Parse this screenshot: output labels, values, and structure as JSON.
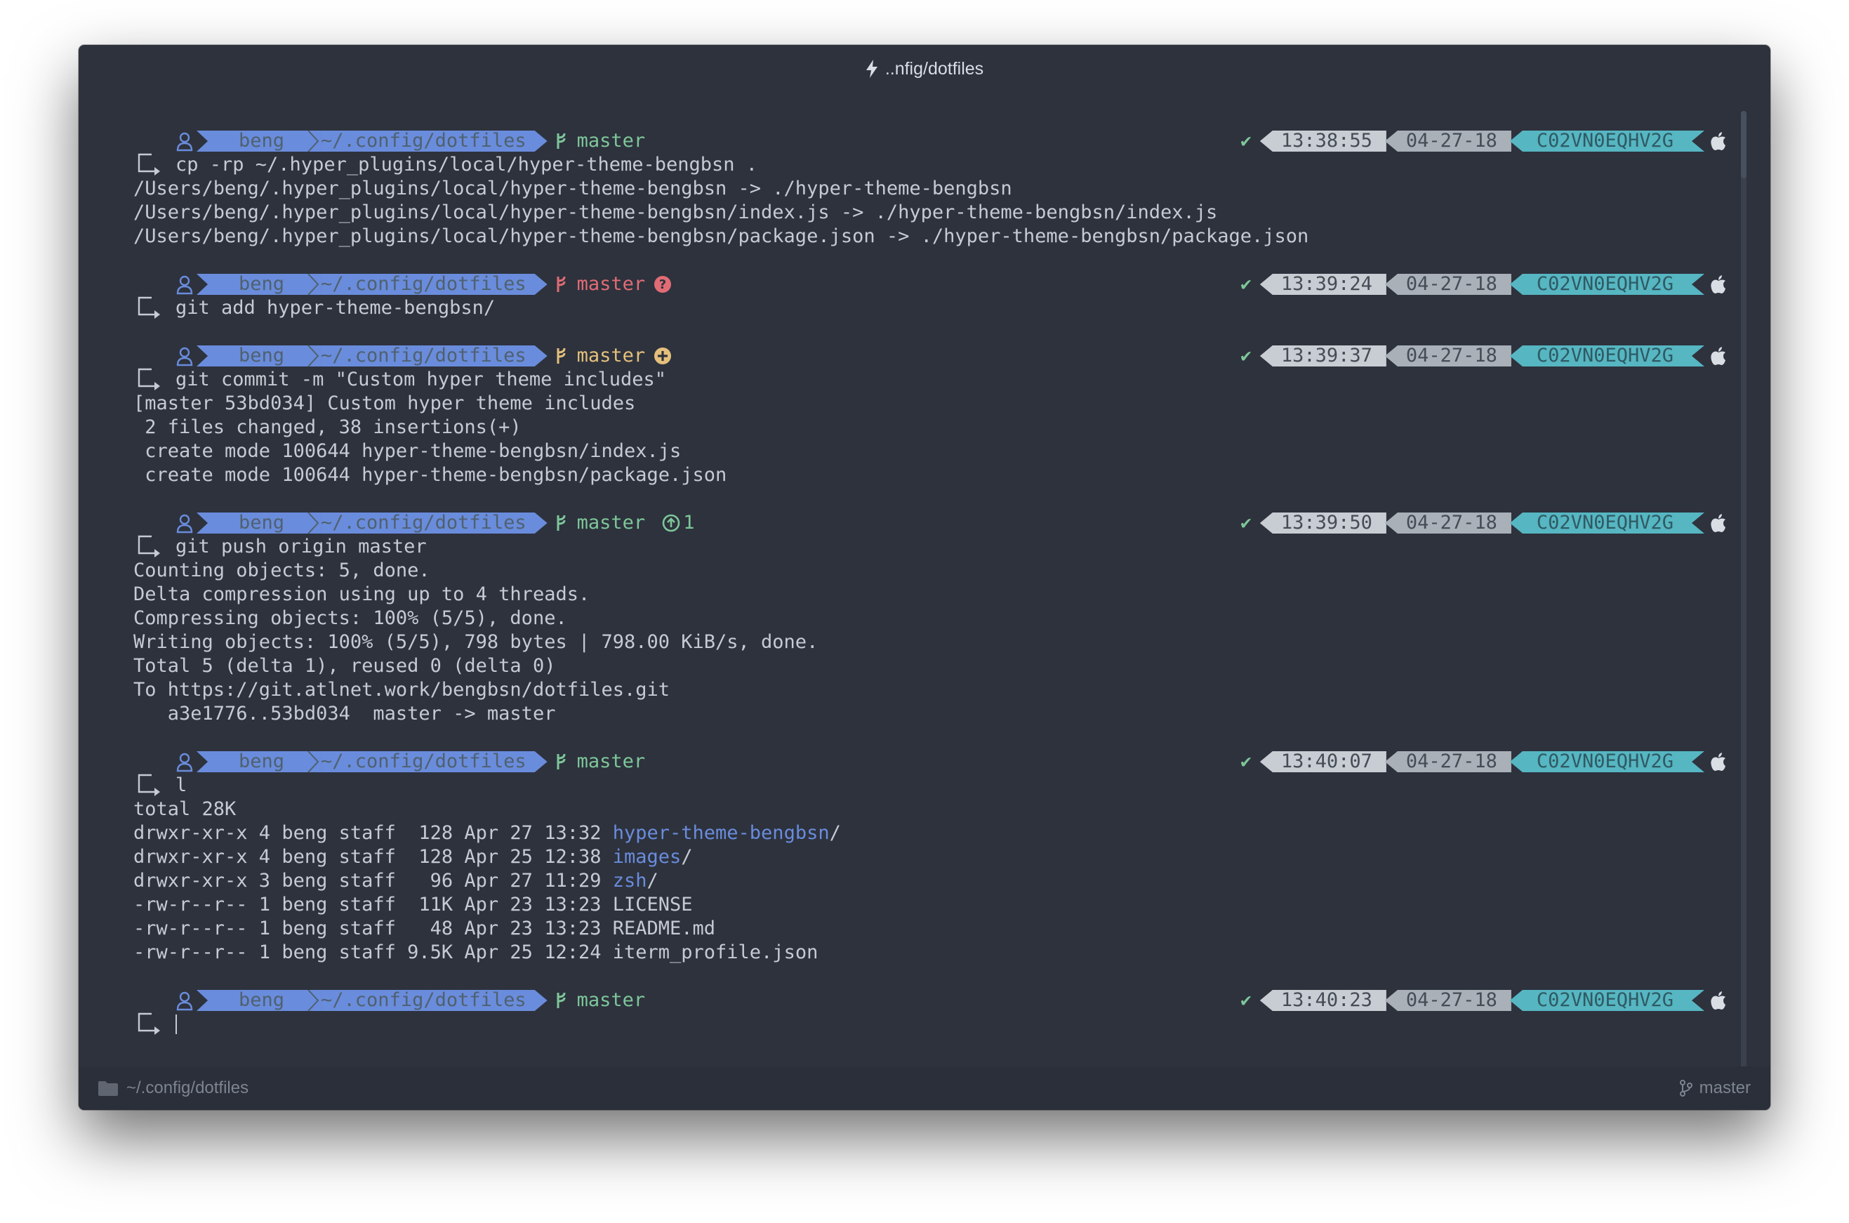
{
  "window": {
    "title": "..nfig/dotfiles",
    "title_icon": "lightning-bolt-icon"
  },
  "colors": {
    "background": "#2d323d",
    "prompt_blue": "#6a8cdc",
    "green": "#7ec699",
    "red": "#e06c75",
    "yellow": "#e5c07b",
    "host_cyan": "#56b6c2"
  },
  "prompts": [
    {
      "user": "beng",
      "dir": "~/.config/dotfiles",
      "branch": "master",
      "branch_state": "clean",
      "status": "",
      "time": "13:38:55",
      "date": "04-27-18",
      "host": "C02VN0EQHV2G",
      "command": "cp -rp ~/.hyper_plugins/local/hyper-theme-bengbsn .",
      "output": [
        "/Users/beng/.hyper_plugins/local/hyper-theme-bengbsn -> ./hyper-theme-bengbsn",
        "/Users/beng/.hyper_plugins/local/hyper-theme-bengbsn/index.js -> ./hyper-theme-bengbsn/index.js",
        "/Users/beng/.hyper_plugins/local/hyper-theme-bengbsn/package.json -> ./hyper-theme-bengbsn/package.json"
      ]
    },
    {
      "user": "beng",
      "dir": "~/.config/dotfiles",
      "branch": "master",
      "branch_state": "untracked",
      "status": "",
      "time": "13:39:24",
      "date": "04-27-18",
      "host": "C02VN0EQHV2G",
      "command": "git add hyper-theme-bengbsn/",
      "output": []
    },
    {
      "user": "beng",
      "dir": "~/.config/dotfiles",
      "branch": "master",
      "branch_state": "staged",
      "status": "",
      "time": "13:39:37",
      "date": "04-27-18",
      "host": "C02VN0EQHV2G",
      "command": "git commit -m \"Custom hyper theme includes\"",
      "output": [
        "[master 53bd034] Custom hyper theme includes",
        " 2 files changed, 38 insertions(+)",
        " create mode 100644 hyper-theme-bengbsn/index.js",
        " create mode 100644 hyper-theme-bengbsn/package.json"
      ]
    },
    {
      "user": "beng",
      "dir": "~/.config/dotfiles",
      "branch": "master",
      "branch_state": "ahead",
      "status": "1",
      "time": "13:39:50",
      "date": "04-27-18",
      "host": "C02VN0EQHV2G",
      "command": "git push origin master",
      "output": [
        "Counting objects: 5, done.",
        "Delta compression using up to 4 threads.",
        "Compressing objects: 100% (5/5), done.",
        "Writing objects: 100% (5/5), 798 bytes | 798.00 KiB/s, done.",
        "Total 5 (delta 1), reused 0 (delta 0)",
        "To https://git.atlnet.work/bengbsn/dotfiles.git",
        "   a3e1776..53bd034  master -> master"
      ]
    },
    {
      "user": "beng",
      "dir": "~/.config/dotfiles",
      "branch": "master",
      "branch_state": "clean",
      "status": "",
      "time": "13:40:07",
      "date": "04-27-18",
      "host": "C02VN0EQHV2G",
      "command": "l",
      "output": [
        "total 28K"
      ],
      "listing": [
        {
          "meta": "drwxr-xr-x 4 beng staff  128 Apr 27 13:32 ",
          "name": "hyper-theme-bengbsn",
          "suffix": "/",
          "is_dir": true
        },
        {
          "meta": "drwxr-xr-x 4 beng staff  128 Apr 25 12:38 ",
          "name": "images",
          "suffix": "/",
          "is_dir": true
        },
        {
          "meta": "drwxr-xr-x 3 beng staff   96 Apr 27 11:29 ",
          "name": "zsh",
          "suffix": "/",
          "is_dir": true
        },
        {
          "meta": "-rw-r--r-- 1 beng staff  11K Apr 23 13:23 ",
          "name": "LICENSE",
          "suffix": "",
          "is_dir": false
        },
        {
          "meta": "-rw-r--r-- 1 beng staff   48 Apr 23 13:23 ",
          "name": "README.md",
          "suffix": "",
          "is_dir": false
        },
        {
          "meta": "-rw-r--r-- 1 beng staff 9.5K Apr 25 12:24 ",
          "name": "iterm_profile.json",
          "suffix": "",
          "is_dir": false
        }
      ]
    },
    {
      "user": "beng",
      "dir": "~/.config/dotfiles",
      "branch": "master",
      "branch_state": "clean",
      "status": "",
      "time": "13:40:23",
      "date": "04-27-18",
      "host": "C02VN0EQHV2G",
      "command": "",
      "output": [],
      "active": true
    }
  ],
  "footer": {
    "cwd": "~/.config/dotfiles",
    "branch": "master",
    "folder_icon": "folder-icon",
    "branch_icon": "git-branch-icon"
  }
}
